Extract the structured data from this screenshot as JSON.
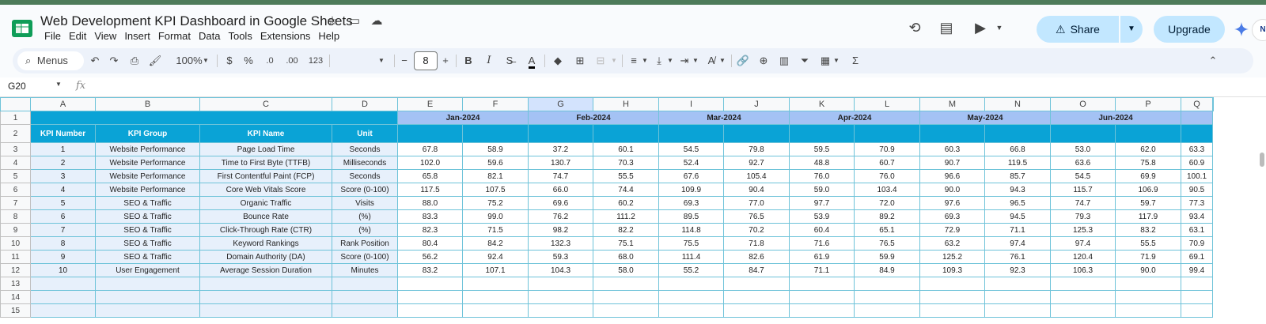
{
  "title": "Web Development KPI Dashboard in Google Sheets",
  "menu": [
    "File",
    "Edit",
    "View",
    "Insert",
    "Format",
    "Data",
    "Tools",
    "Extensions",
    "Help"
  ],
  "share_label": "Share",
  "upgrade_label": "Upgrade",
  "avatar_text": "N",
  "toolbar": {
    "search_label": "Menus",
    "zoom": "100%",
    "currency": "$",
    "percent": "%",
    "dec_dec": ".0",
    "inc_dec": ".00",
    "number_format": "123",
    "font_size": "8",
    "bold": "B",
    "italic": "I",
    "sigma": "Σ"
  },
  "formula": {
    "cell_ref": "G20",
    "fx": "fx"
  },
  "columns": [
    "A",
    "B",
    "C",
    "D",
    "E",
    "F",
    "G",
    "H",
    "I",
    "J",
    "K",
    "L",
    "M",
    "N",
    "O",
    "P",
    "Q"
  ],
  "selected_column": "G",
  "row_numbers": [
    "1",
    "2",
    "3",
    "4",
    "5",
    "6",
    "7",
    "8",
    "9",
    "10",
    "11",
    "12",
    "13",
    "14",
    "15"
  ],
  "headers": [
    "KPI Number",
    "KPI Group",
    "KPI Name",
    "Unit"
  ],
  "months": [
    "Jan-2024",
    "Feb-2024",
    "Mar-2024",
    "Apr-2024",
    "May-2024",
    "Jun-2024"
  ],
  "rows": [
    {
      "num": "1",
      "group": "Website Performance",
      "name": "Page Load Time",
      "unit": "Seconds",
      "values": [
        "67.8",
        "58.9",
        "37.2",
        "60.1",
        "54.5",
        "79.8",
        "59.5",
        "70.9",
        "60.3",
        "66.8",
        "53.0",
        "62.0",
        "63.3"
      ]
    },
    {
      "num": "2",
      "group": "Website Performance",
      "name": "Time to First Byte (TTFB)",
      "unit": "Milliseconds",
      "values": [
        "102.0",
        "59.6",
        "130.7",
        "70.3",
        "52.4",
        "92.7",
        "48.8",
        "60.7",
        "90.7",
        "119.5",
        "63.6",
        "75.8",
        "60.9"
      ]
    },
    {
      "num": "3",
      "group": "Website Performance",
      "name": "First Contentful Paint (FCP)",
      "unit": "Seconds",
      "values": [
        "65.8",
        "82.1",
        "74.7",
        "55.5",
        "67.6",
        "105.4",
        "76.0",
        "76.0",
        "96.6",
        "85.7",
        "54.5",
        "69.9",
        "100.1"
      ]
    },
    {
      "num": "4",
      "group": "Website Performance",
      "name": "Core Web Vitals Score",
      "unit": "Score (0-100)",
      "values": [
        "117.5",
        "107.5",
        "66.0",
        "74.4",
        "109.9",
        "90.4",
        "59.0",
        "103.4",
        "90.0",
        "94.3",
        "115.7",
        "106.9",
        "90.5"
      ]
    },
    {
      "num": "5",
      "group": "SEO & Traffic",
      "name": "Organic Traffic",
      "unit": "Visits",
      "values": [
        "88.0",
        "75.2",
        "69.6",
        "60.2",
        "69.3",
        "77.0",
        "97.7",
        "72.0",
        "97.6",
        "96.5",
        "74.7",
        "59.7",
        "77.3"
      ]
    },
    {
      "num": "6",
      "group": "SEO & Traffic",
      "name": "Bounce Rate",
      "unit": "(%)",
      "values": [
        "83.3",
        "99.0",
        "76.2",
        "111.2",
        "89.5",
        "76.5",
        "53.9",
        "89.2",
        "69.3",
        "94.5",
        "79.3",
        "117.9",
        "93.4"
      ]
    },
    {
      "num": "7",
      "group": "SEO & Traffic",
      "name": "Click-Through Rate (CTR)",
      "unit": "(%)",
      "values": [
        "82.3",
        "71.5",
        "98.2",
        "82.2",
        "114.8",
        "70.2",
        "60.4",
        "65.1",
        "72.9",
        "71.1",
        "125.3",
        "83.2",
        "63.1"
      ]
    },
    {
      "num": "8",
      "group": "SEO & Traffic",
      "name": "Keyword Rankings",
      "unit": "Rank Position",
      "values": [
        "80.4",
        "84.2",
        "132.3",
        "75.1",
        "75.5",
        "71.8",
        "71.6",
        "76.5",
        "63.2",
        "97.4",
        "97.4",
        "55.5",
        "70.9"
      ]
    },
    {
      "num": "9",
      "group": "SEO & Traffic",
      "name": "Domain Authority (DA)",
      "unit": "Score (0-100)",
      "values": [
        "56.2",
        "92.4",
        "59.3",
        "68.0",
        "111.4",
        "82.6",
        "61.9",
        "59.9",
        "125.2",
        "76.1",
        "120.4",
        "71.9",
        "69.1"
      ]
    },
    {
      "num": "10",
      "group": "User Engagement",
      "name": "Average Session Duration",
      "unit": "Minutes",
      "values": [
        "83.2",
        "107.1",
        "104.3",
        "58.0",
        "55.2",
        "84.7",
        "71.1",
        "84.9",
        "109.3",
        "92.3",
        "106.3",
        "90.0",
        "99.4"
      ]
    }
  ]
}
